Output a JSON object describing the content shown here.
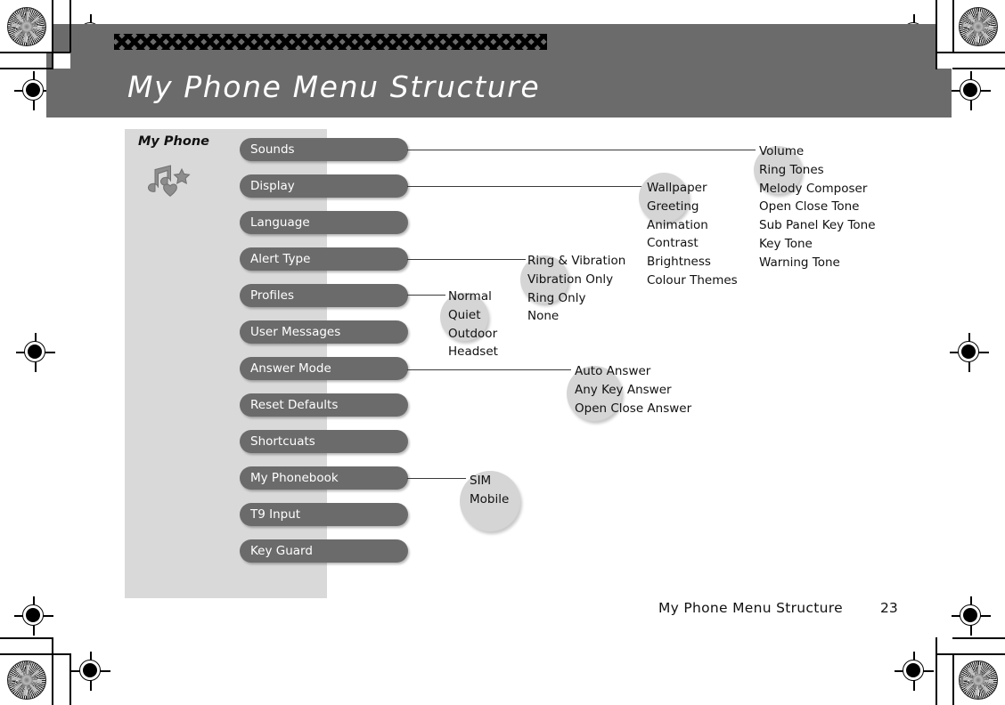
{
  "header": {
    "title": "My Phone Menu Structure",
    "decoration": "diamond-band"
  },
  "panel": {
    "title": "My Phone",
    "icon": "music-notes-star-heart-icon"
  },
  "menu": {
    "items": [
      {
        "label": "Sounds"
      },
      {
        "label": "Display"
      },
      {
        "label": "Language"
      },
      {
        "label": "Alert Type"
      },
      {
        "label": "Profiles"
      },
      {
        "label": "User Messages"
      },
      {
        "label": "Answer Mode"
      },
      {
        "label": "Reset Defaults"
      },
      {
        "label": "Shortcuats"
      },
      {
        "label": "My Phonebook"
      },
      {
        "label": "T9 Input"
      },
      {
        "label": "Key Guard"
      }
    ]
  },
  "submenus": {
    "sounds": {
      "parent": "Sounds",
      "items": [
        "Volume",
        "Ring Tones",
        "Melody Composer",
        "Open Close Tone",
        "Sub Panel Key Tone",
        "Key Tone",
        "Warning Tone"
      ]
    },
    "display": {
      "parent": "Display",
      "items": [
        "Wallpaper",
        "Greeting",
        "Animation",
        "Contrast",
        "Brightness",
        "Colour Themes"
      ]
    },
    "alert_type": {
      "parent": "Alert Type",
      "items": [
        "Ring & Vibration",
        "Vibration Only",
        "Ring Only",
        "None"
      ]
    },
    "profiles": {
      "parent": "Profiles",
      "items": [
        "Normal",
        "Quiet",
        "Outdoor",
        "Headset"
      ]
    },
    "answer_mode": {
      "parent": "Answer Mode",
      "items": [
        "Auto Answer",
        "Any Key Answer",
        "Open Close Answer"
      ]
    },
    "my_phonebook": {
      "parent": "My Phonebook",
      "items": [
        "SIM",
        "Mobile"
      ]
    }
  },
  "footer": {
    "text": "My Phone Menu Structure",
    "page": "23"
  },
  "colors": {
    "header_band": "#6b6b6b",
    "pill": "#6b6b6b",
    "panel": "#d9d9d9",
    "blob": "#d5d5d5",
    "text": "#111111",
    "pill_text": "#ffffff"
  }
}
